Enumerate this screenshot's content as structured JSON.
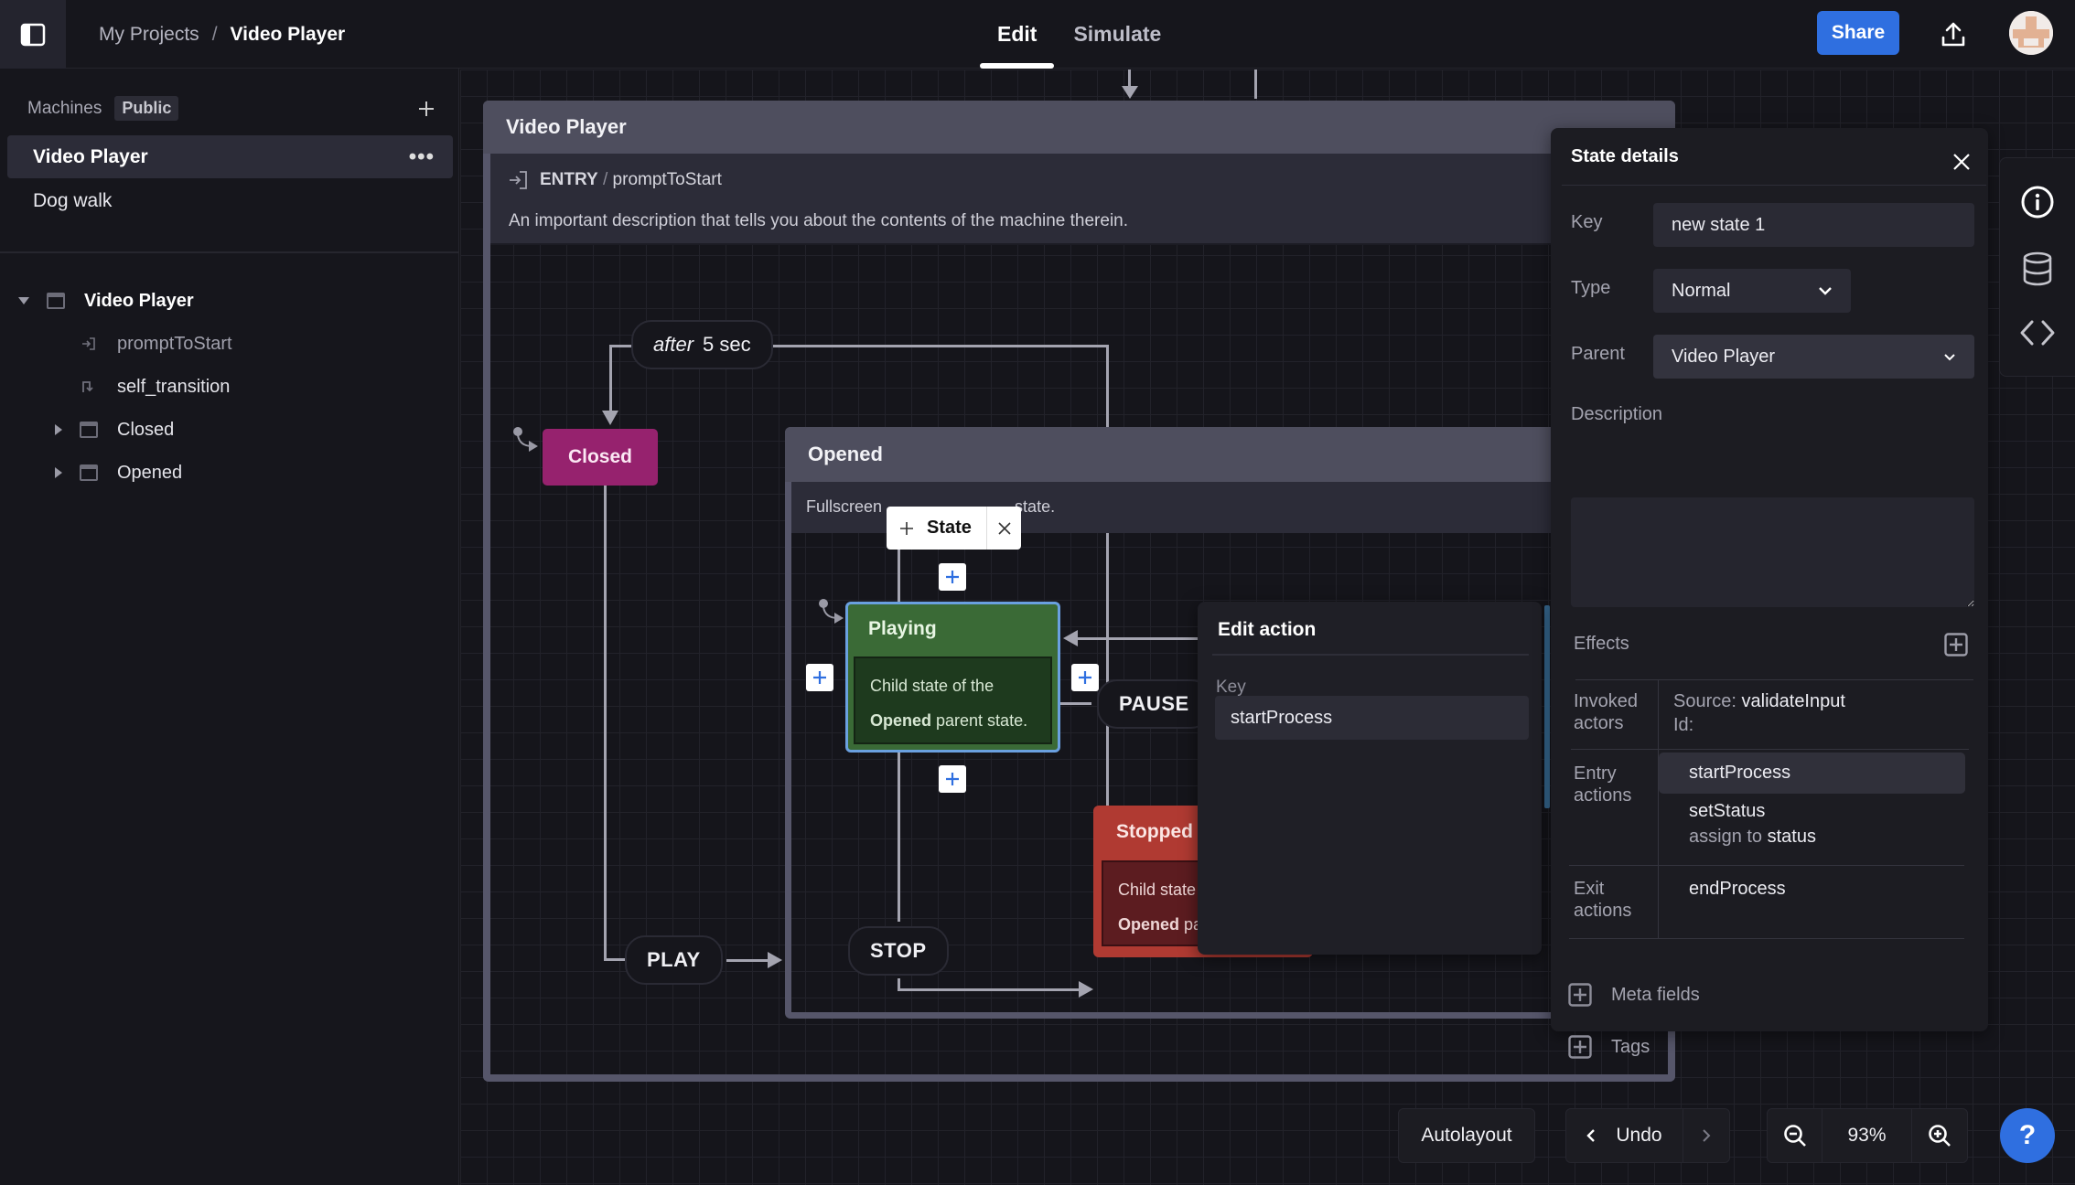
{
  "topbar": {
    "breadcrumb": {
      "parent": "My Projects",
      "separator": "/",
      "current": "Video Player"
    },
    "tabs": [
      {
        "label": "Edit",
        "active": true
      },
      {
        "label": "Simulate",
        "active": false
      }
    ],
    "share_label": "Share",
    "accent_color": "#2f6fe0"
  },
  "sidebar": {
    "machines_label": "Machines",
    "visibility_badge": "Public",
    "machines": [
      {
        "label": "Video Player",
        "active": true
      },
      {
        "label": "Dog walk",
        "active": false
      }
    ],
    "tree": {
      "root": "Video Player",
      "children": [
        {
          "label": "promptToStart",
          "kind": "entry-action"
        },
        {
          "label": "self_transition",
          "kind": "transition"
        },
        {
          "label": "Closed",
          "kind": "state"
        },
        {
          "label": "Opened",
          "kind": "state"
        }
      ]
    }
  },
  "canvas": {
    "root_state": {
      "title": "Video Player",
      "entry_keyword": "ENTRY",
      "entry_separator": "/",
      "entry_action": "promptToStart",
      "description": "An important description that tells you about the contents of the machine therein."
    },
    "events": {
      "after": {
        "keyword": "after",
        "value": "5 sec"
      },
      "play": "PLAY",
      "stop": "STOP",
      "pause": "PAUSE"
    },
    "closed_state": {
      "title": "Closed",
      "color": "#96226e"
    },
    "opened_state": {
      "title": "Opened",
      "description": "Fullscreen ... state."
    },
    "state_popup": {
      "label": "State"
    },
    "playing_state": {
      "title": "Playing",
      "desc_line1": "Child state of the",
      "desc_bold": "Opened",
      "desc_rest": " parent state.",
      "color": "#3a6a36"
    },
    "stopped_state": {
      "title": "Stopped",
      "desc_line1": "Child state",
      "desc_bold": "Opened",
      "desc_rest": " pa",
      "color": "#b03a32"
    }
  },
  "edit_action": {
    "title": "Edit action",
    "key_label": "Key",
    "key_value": "startProcess"
  },
  "state_details": {
    "title": "State details",
    "key_label": "Key",
    "key_value": "new state 1",
    "type_label": "Type",
    "type_value": "Normal",
    "parent_label": "Parent",
    "parent_value": "Video Player",
    "description_label": "Description",
    "description_value": "",
    "effects_label": "Effects",
    "invoked_label_1": "Invoked",
    "invoked_label_2": "actors",
    "invoked_source_label": "Source:",
    "invoked_source_value": "validateInput",
    "invoked_id_label": "Id:",
    "entry_label_1": "Entry",
    "entry_label_2": "actions",
    "entry_actions": [
      {
        "name": "startProcess"
      },
      {
        "name": "setStatus",
        "detail_prefix": "assign to",
        "detail_value": "status"
      }
    ],
    "exit_label_1": "Exit",
    "exit_label_2": "actions",
    "exit_actions": [
      {
        "name": "endProcess"
      }
    ],
    "meta_fields_label": "Meta fields",
    "tags_label": "Tags"
  },
  "bottom_controls": {
    "autolayout_label": "Autolayout",
    "undo_label": "Undo",
    "zoom_level": "93%",
    "help_label": "?"
  }
}
